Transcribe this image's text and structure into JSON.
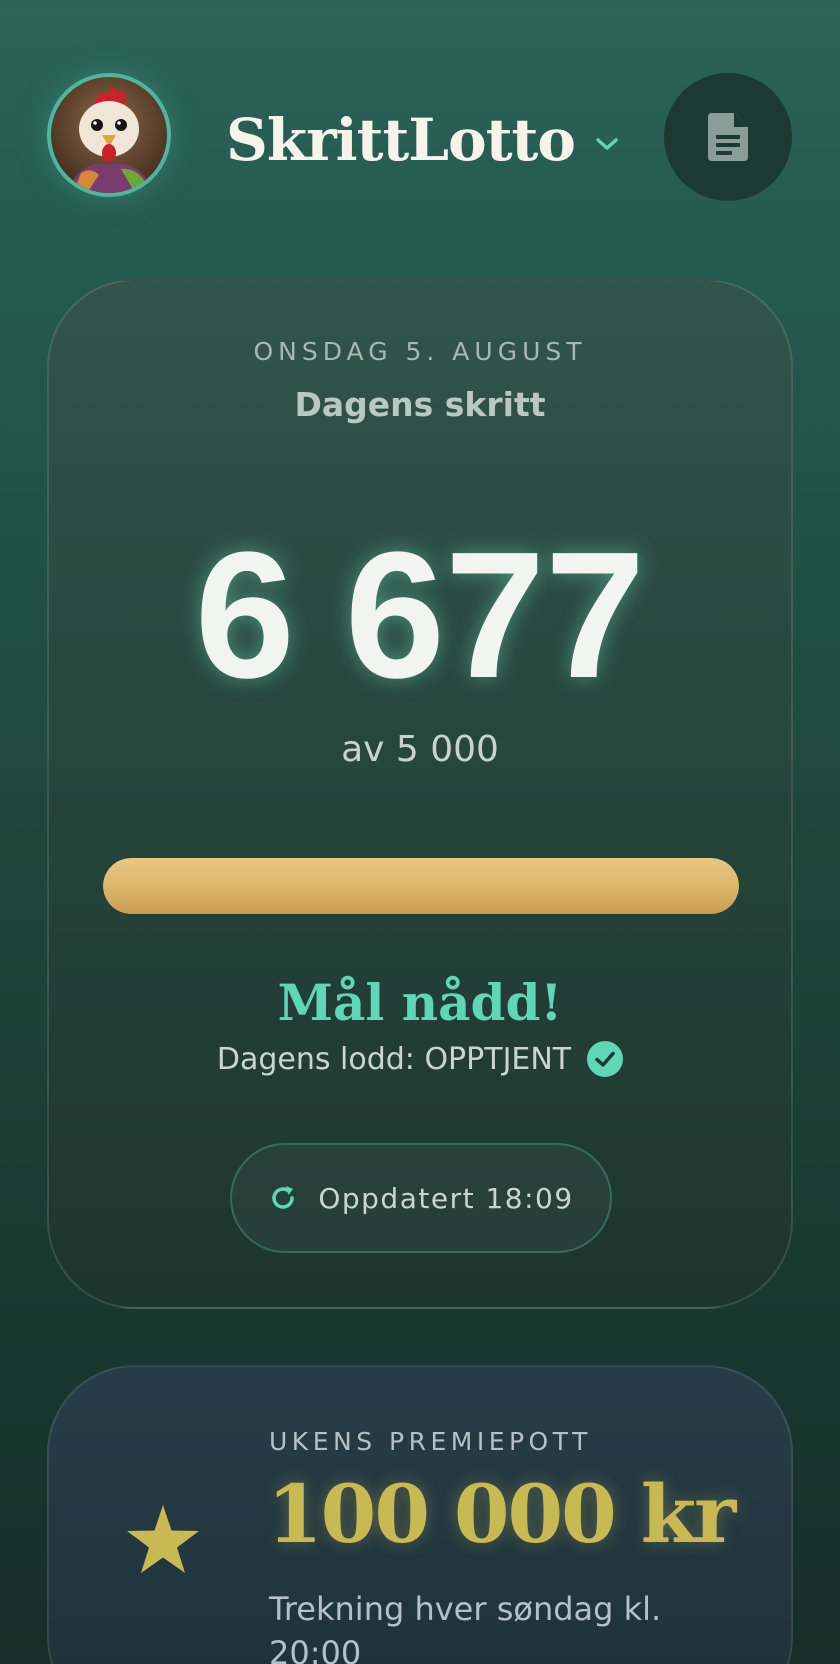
{
  "header": {
    "app_name": "SkrittLotto",
    "avatar_alt": "avatar",
    "doc_icon": "document-icon",
    "dropdown_icon": "chevron-down-icon"
  },
  "steps_card": {
    "date": "ONSDAG 5. AUGUST",
    "title": "Dagens skritt",
    "steps": "6 677",
    "goal_text": "av 5 000",
    "progress": 1.0,
    "goal_status": "Mål nådd!",
    "ticket_status": "Dagens lodd: OPPTJENT",
    "ticket_icon": "check-circle-icon",
    "updated_label": "Oppdatert 18:09",
    "refresh_icon": "refresh-icon"
  },
  "prize_card": {
    "label": "UKENS PREMIEPOTT",
    "amount": "100 000 kr",
    "draw_info": "Trekning hver søndag kl. 20:00",
    "icon": "star-icon"
  },
  "colors": {
    "accent": "#5fd6b5",
    "progress_gold": "#dbb46a",
    "prize_gold": "#c9b954"
  }
}
